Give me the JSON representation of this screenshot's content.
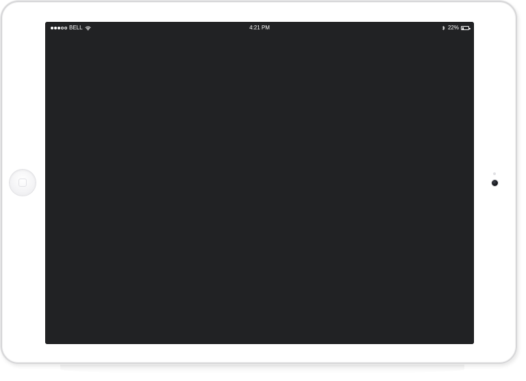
{
  "device": {
    "type": "tablet",
    "orientation": "landscape",
    "frame_color": "#ffffff",
    "screen_color": "#212224"
  },
  "status_bar": {
    "signal": {
      "filled_dots": 3,
      "total_dots": 5
    },
    "carrier": "BELL",
    "wifi_icon": "wifi-icon",
    "time": "4:21 PM",
    "bluetooth_icon": "bluetooth-icon",
    "battery_percent": "22%",
    "battery_level": 0.22
  },
  "hardware": {
    "home_button_icon": "home-button",
    "camera_icon": "front-camera"
  }
}
